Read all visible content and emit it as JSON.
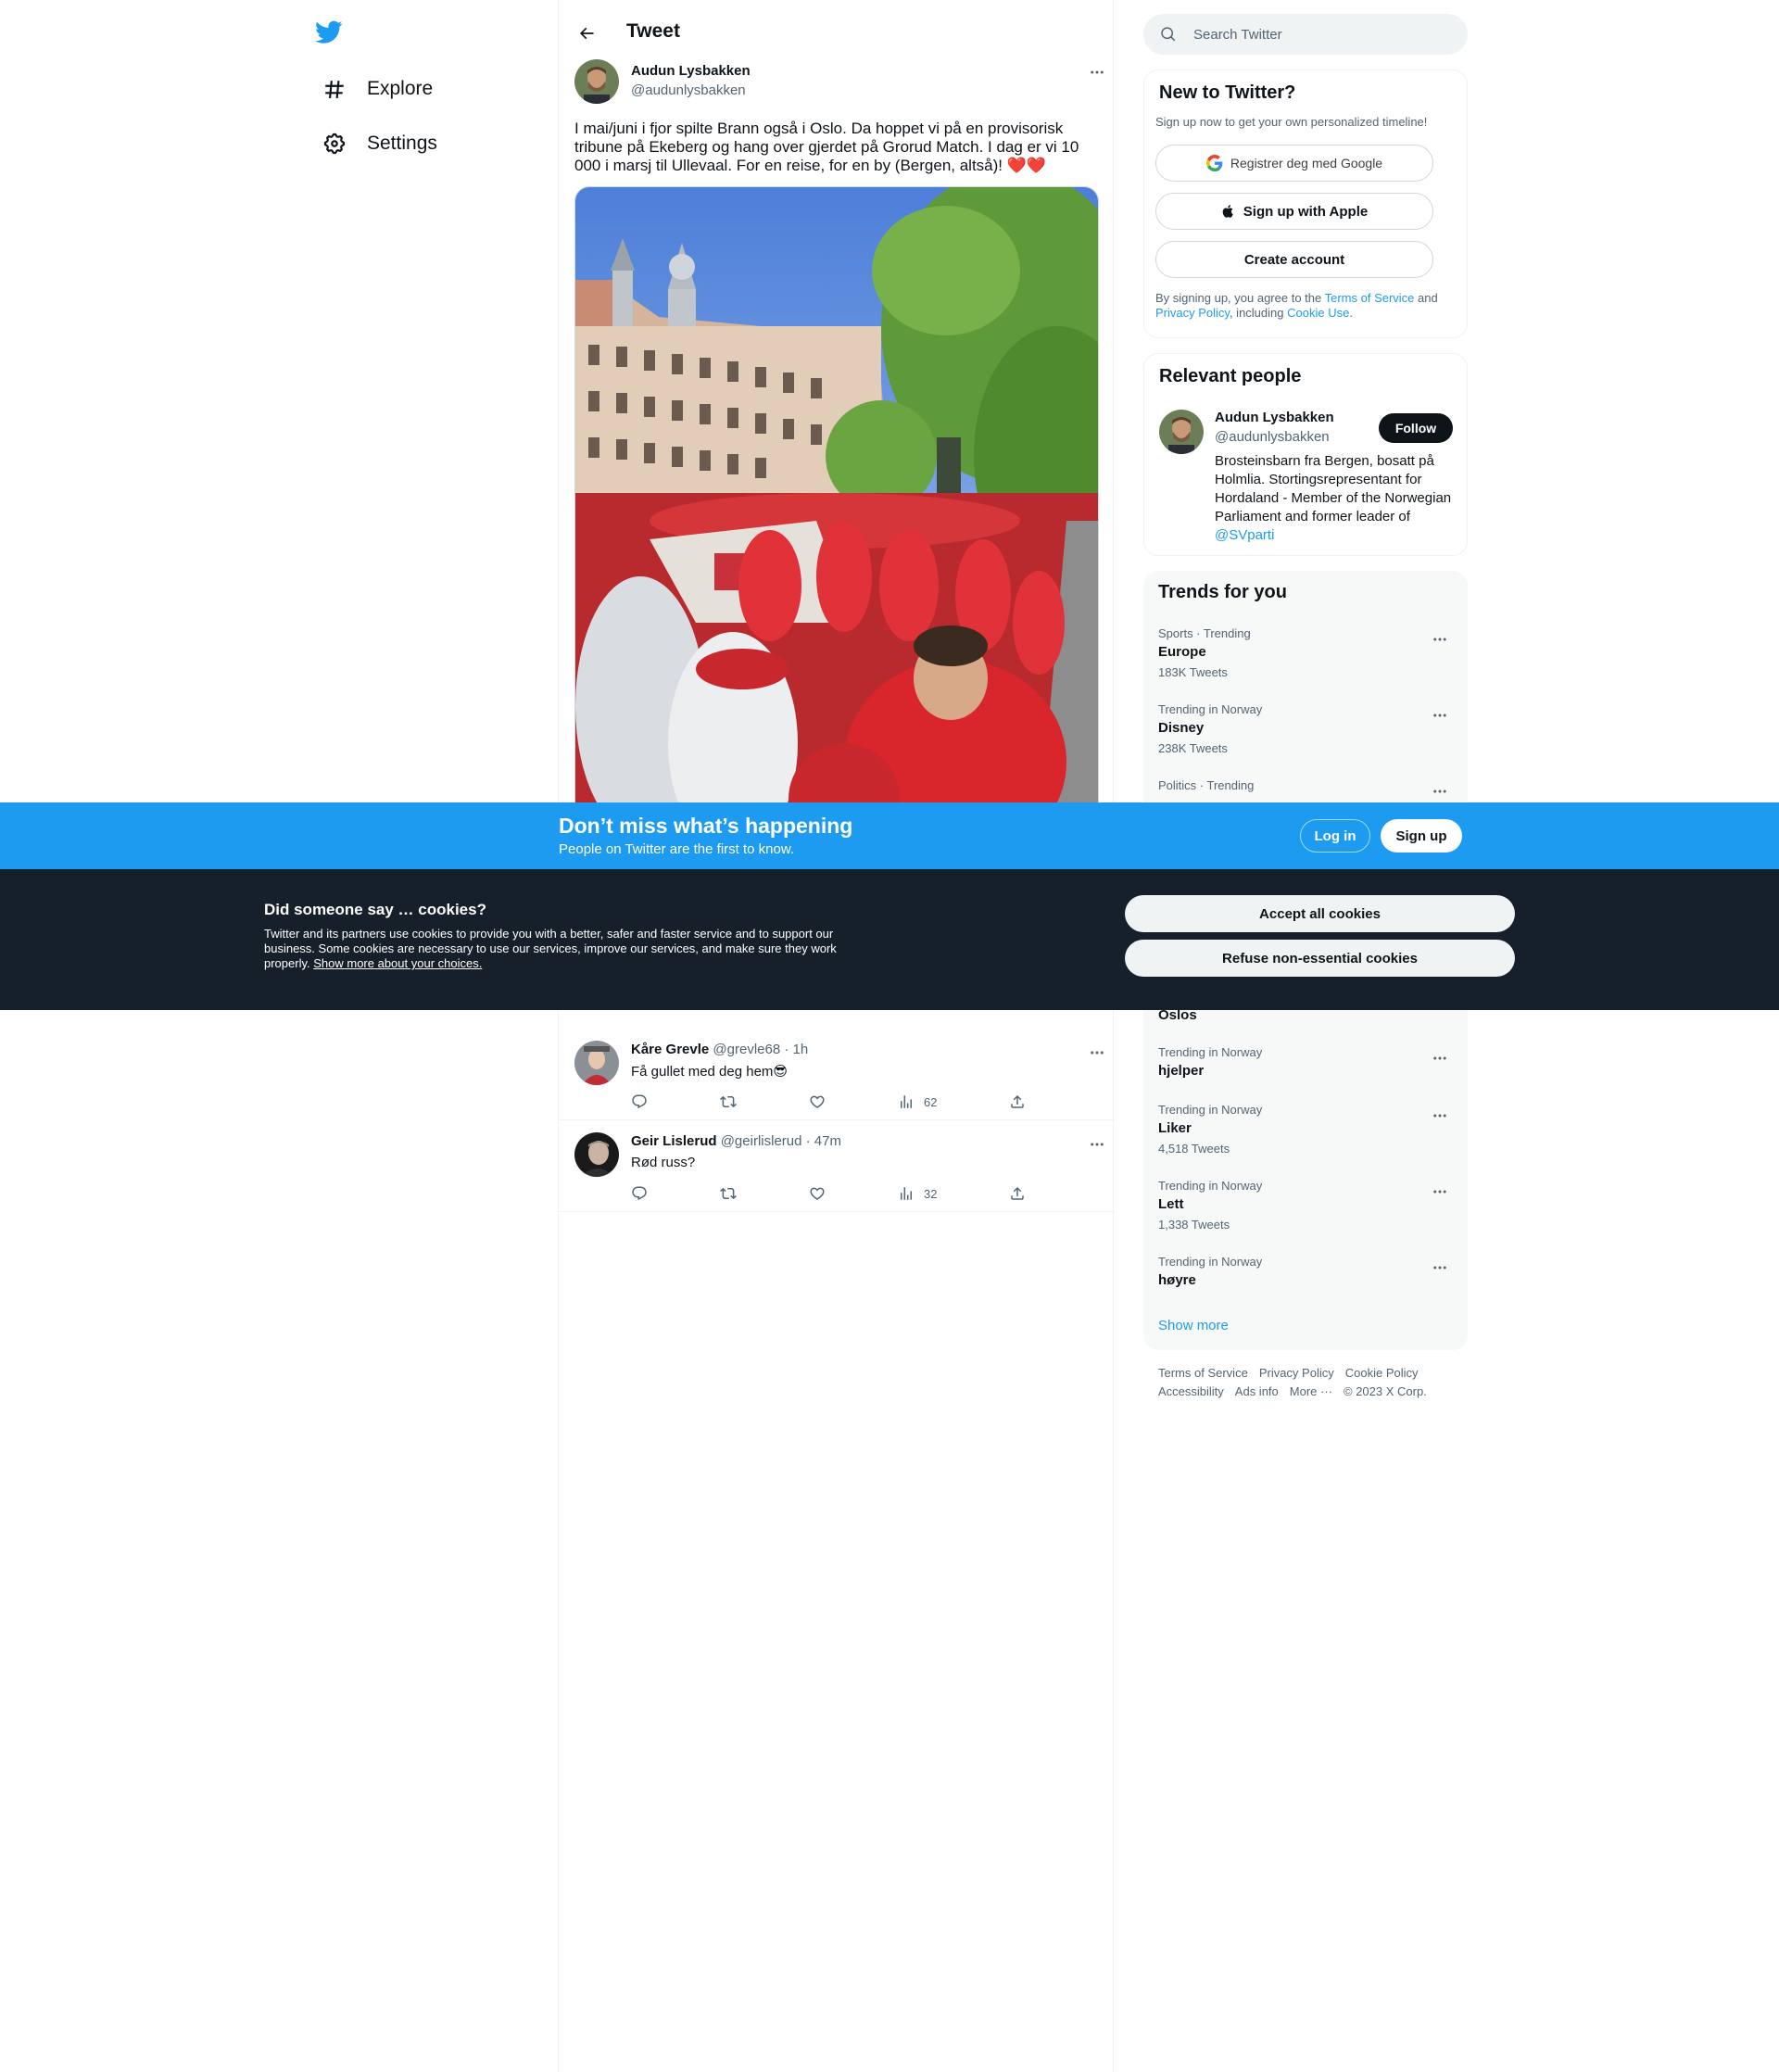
{
  "nav": {
    "items": [
      {
        "label": "Explore",
        "icon": "hashtag-icon"
      },
      {
        "label": "Settings",
        "icon": "gear-icon"
      }
    ]
  },
  "header": {
    "title": "Tweet"
  },
  "tweet": {
    "author_name": "Audun Lysbakken",
    "author_handle": "@audunlysbakken",
    "text": "I mai/juni i fjor spilte Brann også i Oslo. Da hoppet vi på en provisorisk tribune på Ekeberg og hang over gjerdet på Grorud Match. I dag er vi 10 000 i marsj til Ullevaal. For en reise, for en by (Bergen, altså)! ❤️❤️"
  },
  "replies": [
    {
      "name": "Kåre Grevle",
      "handle": "@grevle68",
      "time": "· 1h",
      "text": "Få gullet med deg hem😎",
      "views": "62"
    },
    {
      "name": "Geir Lislerud",
      "handle": "@geirlislerud",
      "time": "· 47m",
      "text": "Rød russ?",
      "views": "32"
    }
  ],
  "search": {
    "placeholder": "Search Twitter"
  },
  "signup_card": {
    "title": "New to Twitter?",
    "subtitle": "Sign up now to get your own personalized timeline!",
    "google_label": "Registrer deg med Google",
    "apple_label": "Sign up with Apple",
    "create_label": "Create account",
    "legal_prefix": "By signing up, you agree to the ",
    "tos": "Terms of Service",
    "and": " and ",
    "privacy": "Privacy Policy",
    "including": ", including ",
    "cookie_use": "Cookie Use",
    "period": "."
  },
  "relevant": {
    "title": "Relevant people",
    "name": "Audun Lysbakken",
    "handle": "@audunlysbakken",
    "follow_label": "Follow",
    "bio": "Brosteinsbarn fra Bergen, bosatt på Holmlia. Stortingsrepresentant for Hordaland - Member of the Norwegian Parliament and former leader of ",
    "bio_link": "@SVparti"
  },
  "trends": {
    "title": "Trends for you",
    "items": [
      {
        "meta": "Sports · Trending",
        "name": "Europe",
        "count": "183K Tweets"
      },
      {
        "meta": "Trending in Norway",
        "name": "Disney",
        "count": "238K Tweets"
      },
      {
        "meta": "Politics · Trending",
        "name": "",
        "count": ""
      },
      {
        "meta": "",
        "name": "Oslos",
        "count": ""
      },
      {
        "meta": "Trending in Norway",
        "name": "hjelper",
        "count": ""
      },
      {
        "meta": "Trending in Norway",
        "name": "Liker",
        "count": "4,518 Tweets"
      },
      {
        "meta": "Trending in Norway",
        "name": "Lett",
        "count": "1,338 Tweets"
      },
      {
        "meta": "Trending in Norway",
        "name": "høyre",
        "count": ""
      }
    ],
    "show_more": "Show more"
  },
  "footer": {
    "links": [
      "Terms of Service",
      "Privacy Policy",
      "Cookie Policy",
      "Accessibility",
      "Ads info",
      "More ···"
    ],
    "copyright": "© 2023 X Corp."
  },
  "banner": {
    "title": "Don’t miss what’s happening",
    "subtitle": "People on Twitter are the first to know.",
    "login_label": "Log in",
    "signup_label": "Sign up"
  },
  "cookies": {
    "title": "Did someone say … cookies?",
    "text": "Twitter and its partners use cookies to provide you with a better, safer and faster service and to support our business. Some cookies are necessary to use our services, improve our services, and make sure they work properly. ",
    "link": "Show more about your choices.",
    "accept_label": "Accept all cookies",
    "refuse_label": "Refuse non-essential cookies"
  },
  "colors": {
    "brand": "#1d9bf0",
    "dark": "#15202b",
    "text": "#0f1419",
    "secondary": "#536471"
  }
}
